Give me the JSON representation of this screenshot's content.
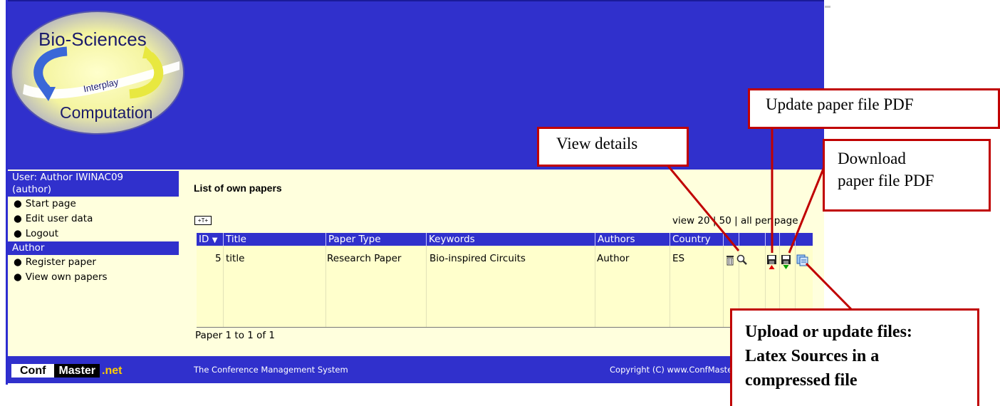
{
  "logo": {
    "top_text": "Bio-Sciences",
    "middle_text": "Interplay",
    "bottom_text": "Computation"
  },
  "sidebar": {
    "user_line": "User: Author IWINAC09",
    "role_line": "(author)",
    "user_items": [
      {
        "label": "Start page"
      },
      {
        "label": "Edit user data"
      },
      {
        "label": "Logout"
      }
    ],
    "section_label": "Author",
    "author_items": [
      {
        "label": "Register paper"
      },
      {
        "label": "View own papers"
      }
    ]
  },
  "main": {
    "title": "List of own papers",
    "toggle_label": "+T+",
    "view_per_page": "view 20 | 50 | all per page",
    "columns": [
      "ID",
      "Title",
      "Paper Type",
      "Keywords",
      "Authors",
      "Country"
    ],
    "sort_indicator": "▼",
    "rows": [
      {
        "id": "5",
        "title": "title",
        "paper_type": "Research Paper",
        "keywords": "Bio-inspired Circuits",
        "authors": "Author",
        "country": "ES"
      }
    ],
    "pagination": "Paper 1 to 1 of 1"
  },
  "icons": [
    "trash-icon",
    "magnifier-icon",
    "save-upload-icon",
    "save-download-icon",
    "files-upload-icon"
  ],
  "footer": {
    "brand_conf": "Conf",
    "brand_master": "Master",
    "brand_net": ".net",
    "tagline": "The Conference Management System",
    "copyright": "Copyright (C) www.ConfMaster.net"
  },
  "callouts": {
    "update": "Update paper file PDF",
    "view": "View details",
    "download_1": "Download",
    "download_2": "paper file PDF",
    "upload_1": "Upload or update files:",
    "upload_2": "Latex Sources in a",
    "upload_3": "compressed file"
  },
  "colors": {
    "header_blue": "#3030cc",
    "panel_yellow": "#ffffdd",
    "callout_red": "#c00000"
  }
}
